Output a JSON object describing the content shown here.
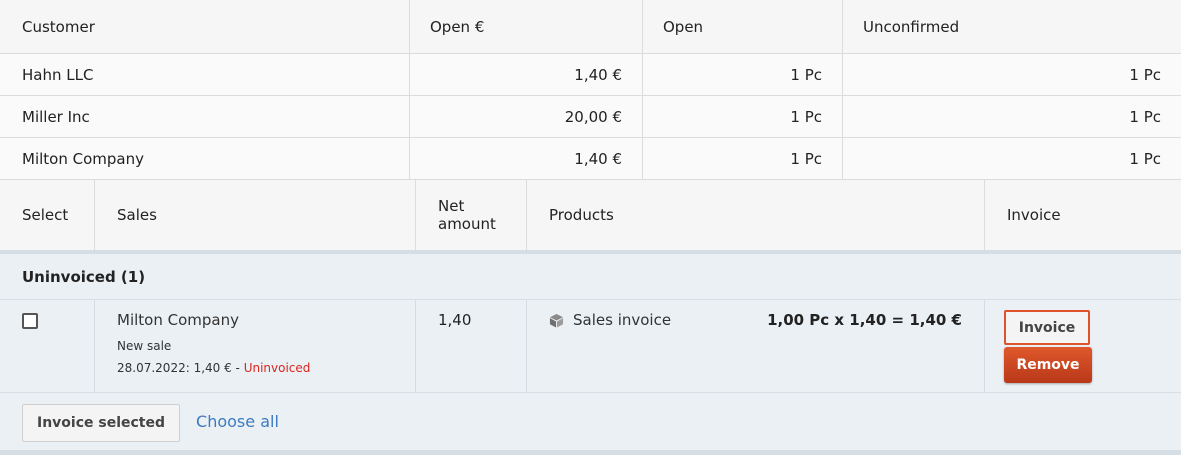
{
  "customers": {
    "headers": [
      "Customer",
      "Open €",
      "Open",
      "Unconfirmed"
    ],
    "rows": [
      {
        "name": "Hahn LLC",
        "open_eur": "1,40 €",
        "open": "1 Pc",
        "unconfirmed": "1 Pc"
      },
      {
        "name": "Miller Inc",
        "open_eur": "20,00 €",
        "open": "1 Pc",
        "unconfirmed": "1 Pc"
      },
      {
        "name": "Milton Company",
        "open_eur": "1,40 €",
        "open": "1 Pc",
        "unconfirmed": "1 Pc"
      }
    ]
  },
  "sales": {
    "headers": {
      "select": "Select",
      "sales": "Sales",
      "net_amount": "Net amount",
      "products": "Products",
      "invoice": "Invoice"
    },
    "group_label": "Uninvoiced (1)",
    "items": [
      {
        "customer": "Milton Company",
        "type": "New sale",
        "date_amount": "28.07.2022: 1,40 € - ",
        "status": "Uninvoiced",
        "net_amount": "1,40",
        "product_icon": "box-icon",
        "product_name": "Sales invoice",
        "calculation": "1,00 Pc x 1,40 = 1,40 €",
        "invoice_button": "Invoice",
        "remove_button": "Remove"
      }
    ],
    "footer": {
      "invoice_selected": "Invoice selected",
      "choose_all": "Choose all"
    }
  },
  "colors": {
    "accent_red": "#d9251d",
    "remove_button": "#c9401c",
    "link_blue": "#3b7bbf",
    "group_background": "#ebf0f4"
  }
}
